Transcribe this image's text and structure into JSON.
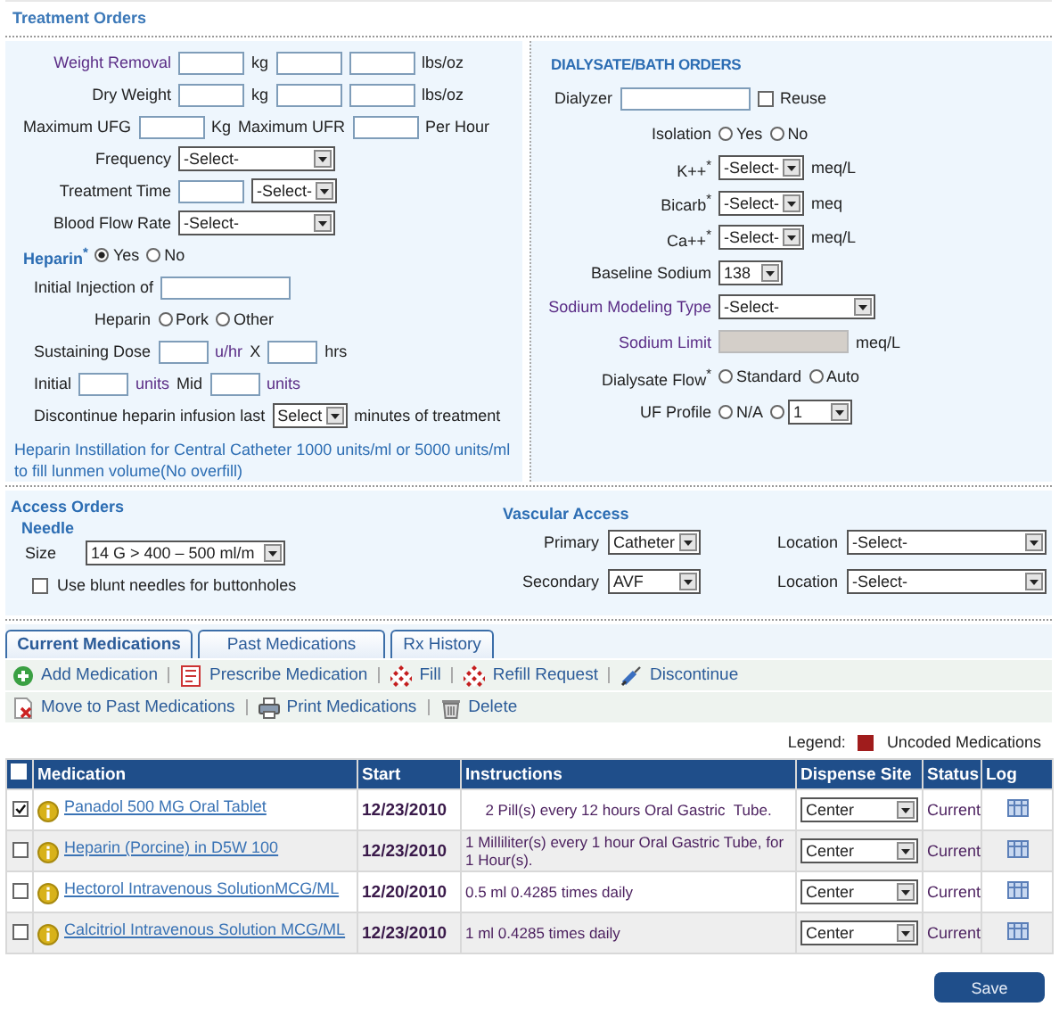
{
  "title": "Treatment Orders",
  "treatment": {
    "rows": [
      {
        "kind": "labeled",
        "label": {
          "kind": "accent",
          "text": "Weight Removal"
        },
        "items": [
          {
            "kind": "field"
          },
          {
            "kind": "text",
            "text": "kg"
          },
          {
            "kind": "field"
          },
          {
            "kind": "field"
          },
          {
            "kind": "text",
            "text": "lbs/oz"
          }
        ]
      },
      {
        "kind": "labeled",
        "label": {
          "kind": "text",
          "text": "Dry Weight"
        },
        "items": [
          {
            "kind": "field"
          },
          {
            "kind": "text",
            "text": "kg"
          },
          {
            "kind": "field"
          },
          {
            "kind": "field"
          },
          {
            "kind": "text",
            "text": "lbs/oz"
          }
        ]
      },
      {
        "kind": "flow",
        "items": [
          {
            "kind": "text",
            "text": "Maximum UFG"
          },
          {
            "kind": "field"
          },
          {
            "kind": "text",
            "text": "Kg"
          },
          {
            "kind": "text",
            "text": "Maximum UFR"
          },
          {
            "kind": "field"
          },
          {
            "kind": "text",
            "text": "Per Hour"
          }
        ]
      },
      {
        "kind": "labeled",
        "label": {
          "kind": "text",
          "text": "Frequency"
        },
        "items": [
          {
            "kind": "wide_select",
            "value": "-Select-"
          }
        ]
      },
      {
        "kind": "labeled",
        "label": {
          "kind": "text",
          "text": "Treatment Time"
        },
        "items": [
          {
            "kind": "field"
          },
          {
            "kind": "select",
            "value": "-Select-"
          }
        ]
      },
      {
        "kind": "labeled",
        "label": {
          "kind": "text",
          "text": "Blood Flow Rate"
        },
        "items": [
          {
            "kind": "wide_select",
            "value": "-Select-"
          }
        ]
      },
      {
        "kind": "flow",
        "items": [
          {
            "kind": "heading",
            "text": "Heparin$^{*}$"
          },
          {
            "kind": "radio",
            "label": "Yes",
            "selected": true
          },
          {
            "kind": "radio",
            "label": "No",
            "selected": false
          }
        ]
      },
      {
        "kind": "indented",
        "items": [
          {
            "kind": "text",
            "text": "Initial Injection of"
          },
          {
            "kind": "long_field"
          }
        ]
      },
      {
        "kind": "deep",
        "items": [
          {
            "kind": "text",
            "text": "Heparin"
          },
          {
            "kind": "radio",
            "label": "Pork",
            "selected": false
          },
          {
            "kind": "radio",
            "label": "Other",
            "selected": false
          }
        ]
      },
      {
        "kind": "indented",
        "items": [
          {
            "kind": "text",
            "text": "Sustaining Dose"
          },
          {
            "kind": "short_field"
          },
          {
            "kind": "accent",
            "text": "u/hr"
          },
          {
            "kind": "text",
            "text": "X"
          },
          {
            "kind": "short_field"
          },
          {
            "kind": "text",
            "text": "hrs"
          }
        ]
      },
      {
        "kind": "indented",
        "items": [
          {
            "kind": "text",
            "text": "Initial"
          },
          {
            "kind": "short_field"
          },
          {
            "kind": "accent",
            "text": "units"
          },
          {
            "kind": "text",
            "text": "Mid"
          },
          {
            "kind": "short_field"
          },
          {
            "kind": "accent",
            "text": "units"
          }
        ]
      },
      {
        "kind": "indented",
        "items": [
          {
            "kind": "text",
            "text": "Discontinue heparin infusion last"
          },
          {
            "kind": "short_select",
            "value": "Select"
          },
          {
            "kind": "text",
            "text": "minutes of treatment"
          }
        ]
      },
      {
        "kind": "note",
        "items": [
          {
            "kind": "note",
            "text": "Heparin Instillation for Central Catheter 1000 units/ml or 5000 units/ml to fill lunmen volume(No overfill)"
          }
        ]
      }
    ]
  },
  "dialysate": {
    "rows": [
      {
        "kind": "flow",
        "items": [
          {
            "kind": "caps_heading",
            "text": "DIALYSATE/BATH ORDERS"
          }
        ]
      },
      {
        "kind": "indented",
        "items": [
          {
            "kind": "text",
            "text": "Dialyzer"
          },
          {
            "kind": "long_field"
          },
          {
            "kind": "checkbox",
            "label": "Reuse",
            "checked": false
          }
        ]
      },
      {
        "kind": "labeled",
        "label": {
          "kind": "text",
          "text": "Isolation"
        },
        "items": [
          {
            "kind": "radio",
            "label": "Yes",
            "selected": false
          },
          {
            "kind": "radio",
            "label": "No",
            "selected": false
          }
        ]
      },
      {
        "kind": "labeled",
        "label": {
          "kind": "text",
          "text": "K++$^{*}$"
        },
        "items": [
          {
            "kind": "select",
            "value": "-Select-"
          },
          {
            "kind": "text",
            "text": "meq/L"
          }
        ]
      },
      {
        "kind": "labeled",
        "label": {
          "kind": "text",
          "text": "Bicarb$^{*}$"
        },
        "items": [
          {
            "kind": "select",
            "value": "-Select-"
          },
          {
            "kind": "text",
            "text": "meq"
          }
        ]
      },
      {
        "kind": "labeled",
        "label": {
          "kind": "text",
          "text": "Ca++$^{*}$"
        },
        "items": [
          {
            "kind": "select",
            "value": "-Select-"
          },
          {
            "kind": "text",
            "text": "meq/L"
          }
        ]
      },
      {
        "kind": "labeled",
        "label": {
          "kind": "text",
          "text": "Baseline Sodium"
        },
        "items": [
          {
            "kind": "short_select",
            "value": "138"
          }
        ]
      },
      {
        "kind": "labeled",
        "label": {
          "kind": "accent",
          "text": "Sodium Modeling Type"
        },
        "items": [
          {
            "kind": "wide_select",
            "value": "-Select-"
          }
        ]
      },
      {
        "kind": "labeled",
        "label": {
          "kind": "accent",
          "text": "Sodium Limit"
        },
        "items": [
          {
            "kind": "long_field",
            "disabled": true
          },
          {
            "kind": "text",
            "text": "meq/L"
          }
        ]
      },
      {
        "kind": "labeled",
        "label": {
          "kind": "text",
          "text": "Dialysate Flow$^{*}$"
        },
        "items": [
          {
            "kind": "radio",
            "label": "Standard",
            "selected": false
          },
          {
            "kind": "radio",
            "label": "Auto",
            "selected": false
          }
        ]
      },
      {
        "kind": "labeled",
        "label": {
          "kind": "text",
          "text": "UF Profile"
        },
        "items": [
          {
            "kind": "radio",
            "label": "N/A",
            "selected": false
          },
          {
            "kind": "radio",
            "selected": false
          },
          {
            "kind": "short_select",
            "value": "1"
          }
        ]
      }
    ]
  },
  "access": {
    "title": "Access Orders",
    "needle": {
      "title": "Needle",
      "size_label": "Size",
      "size": "14 G > 400 – 500 ml/m",
      "blunt_label": "Use blunt needles for buttonholes",
      "blunt_checked": false
    },
    "vascular": {
      "title": "Vascular Access",
      "rows": [
        {
          "label": "Primary",
          "value": "Catheter",
          "location_label": "Location",
          "location": "-Select-"
        },
        {
          "label": "Secondary",
          "value": "AVF",
          "location_label": "Location",
          "location": "-Select-"
        }
      ]
    }
  },
  "tabs": [
    {
      "label": "Current Medications",
      "selected": true
    },
    {
      "label": "Past Medications",
      "selected": false
    },
    {
      "label": "Rx History",
      "selected": false
    }
  ],
  "toolbars": [
    [
      {
        "kind": "add",
        "label": "Add Medication"
      },
      {
        "kind": "prescribe",
        "label": "Prescribe Medication"
      },
      {
        "kind": "fill",
        "label": "Fill"
      },
      {
        "kind": "fill",
        "label": "Refill Request"
      },
      {
        "kind": "discontinue",
        "label": "Discontinue"
      }
    ],
    [
      {
        "kind": "move",
        "label": "Move to Past Medications"
      },
      {
        "kind": "print",
        "label": "Print Medications"
      },
      {
        "kind": "delete",
        "label": "Delete"
      }
    ]
  ],
  "legend": {
    "label": "Legend:",
    "items": [
      {
        "label": "Uncoded Medications",
        "color": "#a01c1c"
      }
    ]
  },
  "table": {
    "all_checked": false,
    "columns": [
      "Medication",
      "Start",
      "Instructions",
      "Dispense Site",
      "Status",
      "Log"
    ],
    "rows": [
      {
        "checked": true,
        "medication": "Panadol 500 MG Oral Tablet",
        "start": "12/23/2010",
        "instructions": "2 Pill(s) every 12 hours Oral Gastric  Tube.",
        "dispense": "Center",
        "status": "Current"
      },
      {
        "checked": false,
        "medication": "Heparin (Porcine) in D5W 100",
        "start": "12/23/2010",
        "instructions": "1 Milliliter(s) every 1 hour Oral Gastric Tube, for 1 Hour(s).",
        "dispense": "Center",
        "status": "Current"
      },
      {
        "checked": false,
        "medication": "Hectorol Intravenous SolutionMCG/ML",
        "start": "12/20/2010",
        "instructions": "0.5 ml 0.4285 times daily",
        "dispense": "Center",
        "status": "Current"
      },
      {
        "checked": false,
        "medication": "Calcitriol Intravenous Solution MCG/ML",
        "start": "12/23/2010",
        "instructions": "1 ml 0.4285 times daily",
        "dispense": "Center",
        "status": "Current"
      }
    ]
  },
  "save": "Save"
}
